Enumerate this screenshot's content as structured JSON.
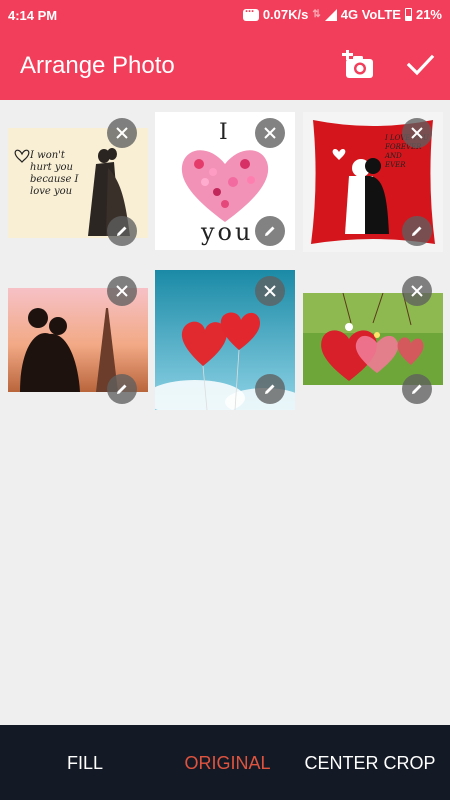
{
  "status": {
    "time": "4:14 PM",
    "speed": "0.07K/s",
    "network": "4G VoLTE",
    "battery": "21%"
  },
  "appbar": {
    "title": "Arrange Photo",
    "add_icon": "add-photo-icon",
    "done_icon": "checkmark-icon"
  },
  "photos": [
    {
      "id": 1,
      "subject": "couple-kiss-sketch",
      "text_lines": [
        "I won't",
        "hurt you",
        "because I",
        "love you"
      ]
    },
    {
      "id": 2,
      "subject": "butterfly-heart",
      "text_top": "I",
      "text_bottom": "you"
    },
    {
      "id": 3,
      "subject": "red-pillow-couple",
      "text_lines": [
        "I LOVE YOU",
        "FOREVER",
        "AND",
        "EVER"
      ]
    },
    {
      "id": 4,
      "subject": "eiffel-tower-couple"
    },
    {
      "id": 5,
      "subject": "heart-balloons-sky"
    },
    {
      "id": 6,
      "subject": "hanging-felt-hearts"
    }
  ],
  "bottom": {
    "options": [
      "FILL",
      "ORIGINAL",
      "CENTER CROP"
    ],
    "selected": "ORIGINAL"
  },
  "colors": {
    "primary": "#f23e5a",
    "bottom_bar": "#141a25",
    "active_option": "#e0533f"
  }
}
